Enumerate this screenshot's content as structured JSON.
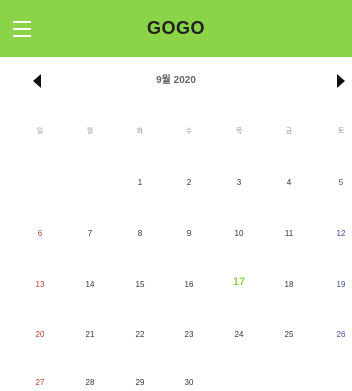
{
  "app": {
    "title": "GOGO"
  },
  "colors": {
    "appbar": "#8bd448",
    "today": "#8bd448",
    "sunday": "#c0392b",
    "saturday": "#3d4a9c"
  },
  "calendar": {
    "month_label": "9월 2020",
    "weekdays": [
      "일",
      "월",
      "화",
      "수",
      "목",
      "금",
      "토"
    ],
    "today": "17",
    "weeks": [
      [
        "",
        "",
        "1",
        "2",
        "3",
        "4",
        "5"
      ],
      [
        "6",
        "7",
        "8",
        "9",
        "10",
        "11",
        "12"
      ],
      [
        "13",
        "14",
        "15",
        "16",
        "17",
        "18",
        "19"
      ],
      [
        "20",
        "21",
        "22",
        "23",
        "24",
        "25",
        "26"
      ],
      [
        "27",
        "28",
        "29",
        "30",
        "",
        "",
        ""
      ]
    ]
  }
}
